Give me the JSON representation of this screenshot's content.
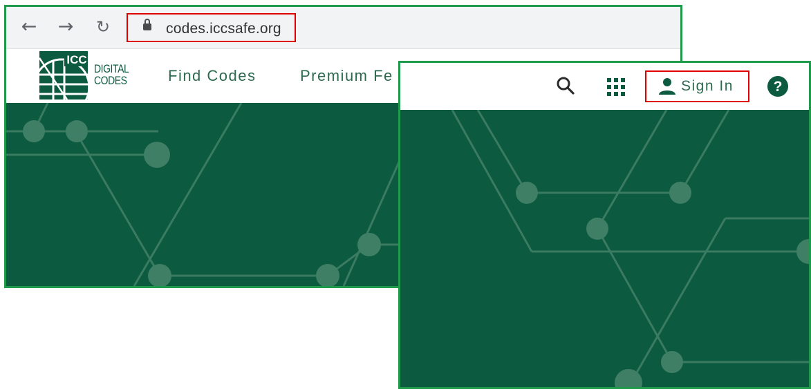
{
  "browser": {
    "url": "codes.iccsafe.org",
    "icons": [
      "back-arrow-icon",
      "forward-arrow-icon",
      "reload-icon",
      "lock-icon"
    ]
  },
  "site": {
    "logo": {
      "mark": "ICC",
      "line1": "DIGITAL",
      "line2": "CODES"
    },
    "nav": [
      {
        "label": "Find Codes"
      },
      {
        "label": "Premium Fe"
      }
    ]
  },
  "zoom_header": {
    "sign_in_label": "Sign In",
    "icons": [
      "search-icon",
      "apps-grid-icon",
      "person-icon",
      "help-icon"
    ]
  },
  "colors": {
    "frame": "#1f9a4a",
    "highlight": "#e00000",
    "brand_green": "#0c5a40",
    "text_green": "#2d6a4f"
  }
}
